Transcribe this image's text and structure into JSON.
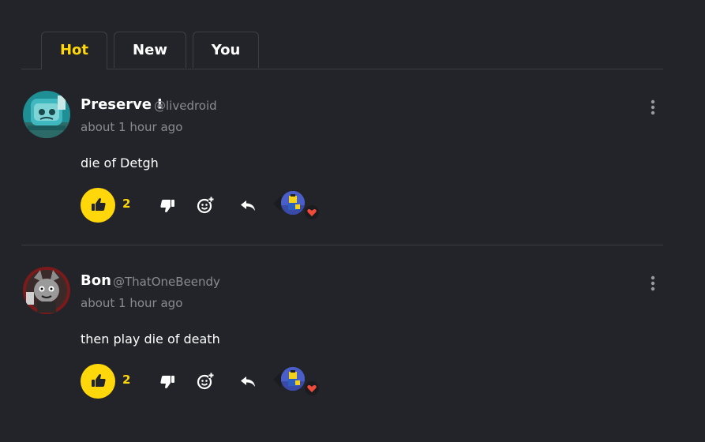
{
  "tabs": [
    {
      "label": "Hot",
      "active": true
    },
    {
      "label": "New",
      "active": false
    },
    {
      "label": "You",
      "active": false
    }
  ],
  "comments": [
    {
      "name": "Preserve !",
      "handle": "@livedroid",
      "time": "about 1 hour ago",
      "text": "die of Detgh",
      "likes": "2"
    },
    {
      "name": "Bon",
      "handle": "@ThatOneBeendy",
      "time": "about 1 hour ago",
      "text": "then play die of death",
      "likes": "2"
    }
  ],
  "colors": {
    "background": "#232429",
    "accent": "#ffd70a",
    "muted_text": "#8a8b91",
    "divider": "#3c3d43",
    "heart": "#f04a3a"
  },
  "icons": {
    "like": "thumbs-up-icon",
    "dislike": "thumbs-down-icon",
    "emoji": "add-emoji-icon",
    "reply": "reply-icon",
    "more": "more-vertical-icon",
    "reaction": "heart-icon"
  }
}
